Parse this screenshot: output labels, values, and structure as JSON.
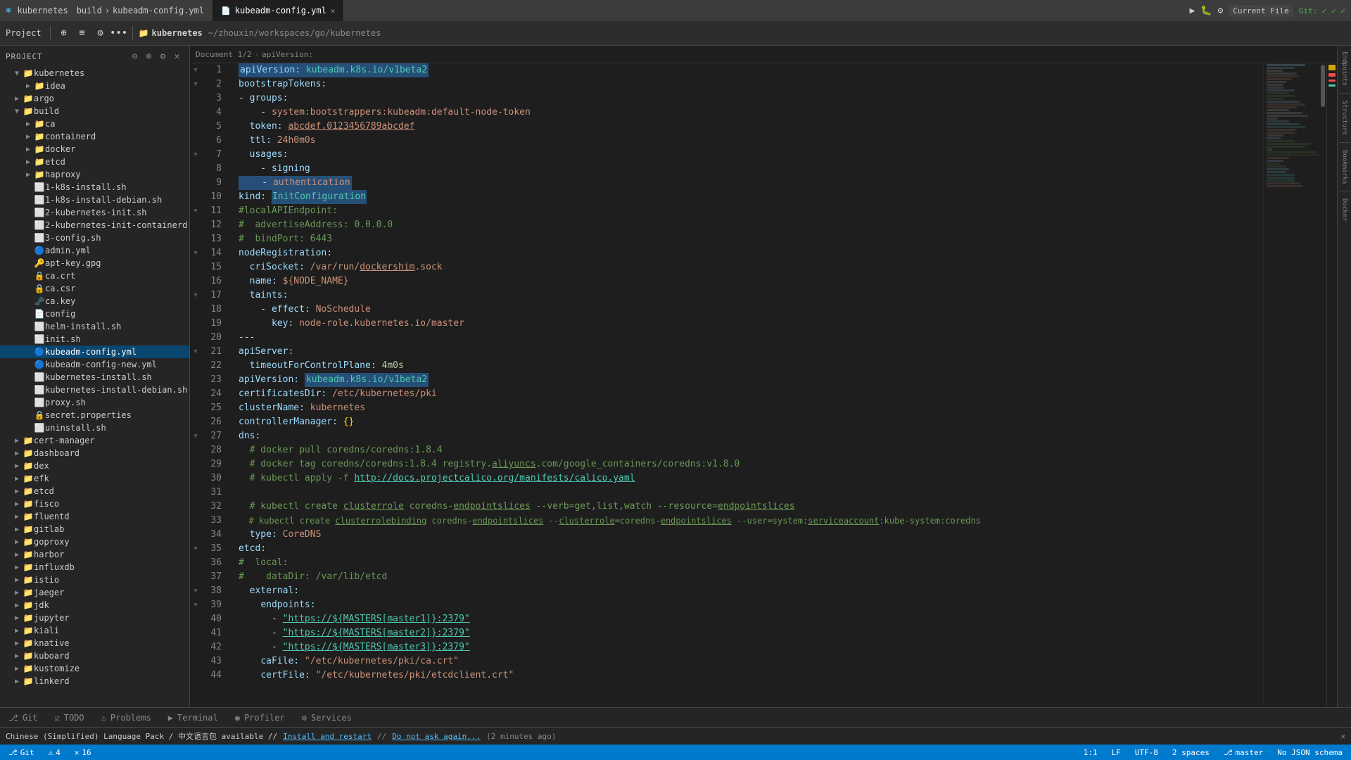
{
  "titleBar": {
    "appName": "kubernetes",
    "breadcrumb": [
      "build",
      "kubeadm-config.yml"
    ],
    "activeTab": "kubeadm-config.yml",
    "rightLabel": "Current File"
  },
  "toolbar": {
    "projectLabel": "Project",
    "folderLabel": "kubernetes",
    "pathLabel": "~/zhouxin/workspaces/go/kubernetes"
  },
  "statusBar": {
    "git": "Git",
    "gitBranch": "master",
    "warnings": "4",
    "errors": "16",
    "position": "1:1",
    "lineEnding": "LF",
    "encoding": "UTF-8",
    "indentation": "2 spaces",
    "noJsonSchema": "No JSON schema"
  },
  "bottomTabs": [
    {
      "id": "git",
      "label": "Git",
      "icon": "⎇"
    },
    {
      "id": "todo",
      "label": "TODO",
      "icon": "☑"
    },
    {
      "id": "problems",
      "label": "Problems",
      "icon": "⚠"
    },
    {
      "id": "terminal",
      "label": "Terminal",
      "icon": ">"
    },
    {
      "id": "profiler",
      "label": "Profiler",
      "icon": "◉"
    },
    {
      "id": "services",
      "label": "Services",
      "icon": "⚙"
    }
  ],
  "notification": {
    "text": "Chinese (Simplified) Language Pack / 中文语言包 available // Install and restart // Do not ask again... (2 minutes ago)"
  },
  "fileTree": {
    "root": "kubernetes",
    "items": [
      {
        "id": "idea",
        "name": "idea",
        "type": "folder",
        "depth": 2,
        "open": false
      },
      {
        "id": "argo",
        "name": "argo",
        "type": "folder",
        "depth": 1,
        "open": false
      },
      {
        "id": "build",
        "name": "build",
        "type": "folder",
        "depth": 1,
        "open": true
      },
      {
        "id": "ca",
        "name": "ca",
        "type": "folder",
        "depth": 2,
        "open": false
      },
      {
        "id": "containerd",
        "name": "containerd",
        "type": "folder",
        "depth": 2,
        "open": false
      },
      {
        "id": "docker",
        "name": "docker",
        "type": "folder",
        "depth": 2,
        "open": false
      },
      {
        "id": "etcd",
        "name": "etcd",
        "type": "folder",
        "depth": 2,
        "open": false
      },
      {
        "id": "haproxy",
        "name": "haproxy",
        "type": "folder",
        "depth": 2,
        "open": false
      },
      {
        "id": "1k8s-install",
        "name": "1-k8s-install.sh",
        "type": "file",
        "ext": "sh",
        "depth": 2
      },
      {
        "id": "1k8s-install-debian",
        "name": "1-k8s-install-debian.sh",
        "type": "file",
        "ext": "sh",
        "depth": 2
      },
      {
        "id": "2kubernetes-init",
        "name": "2-kubernetes-init.sh",
        "type": "file",
        "ext": "sh",
        "depth": 2
      },
      {
        "id": "2kubernetes-init-containerd",
        "name": "2-kubernetes-init-containerd.sh",
        "type": "file",
        "ext": "sh",
        "depth": 2
      },
      {
        "id": "3config",
        "name": "3-config.sh",
        "type": "file",
        "ext": "sh",
        "depth": 2
      },
      {
        "id": "admin-yml",
        "name": "admin.yml",
        "type": "file",
        "ext": "yml",
        "depth": 2
      },
      {
        "id": "apt-key",
        "name": "apt-key.gpg",
        "type": "file",
        "ext": "gpg",
        "depth": 2
      },
      {
        "id": "ca-crt",
        "name": "ca.crt",
        "type": "file",
        "ext": "crt",
        "depth": 2
      },
      {
        "id": "ca-csr",
        "name": "ca.csr",
        "type": "file",
        "ext": "csr",
        "depth": 2
      },
      {
        "id": "ca-key",
        "name": "ca.key",
        "type": "file",
        "ext": "key",
        "depth": 2
      },
      {
        "id": "config",
        "name": "config",
        "type": "file",
        "ext": "",
        "depth": 2
      },
      {
        "id": "helm-install",
        "name": "helm-install.sh",
        "type": "file",
        "ext": "sh",
        "depth": 2
      },
      {
        "id": "init-sh",
        "name": "init.sh",
        "type": "file",
        "ext": "sh",
        "depth": 2
      },
      {
        "id": "kubeadm-config-yml",
        "name": "kubeadm-config.yml",
        "type": "file",
        "ext": "yml",
        "depth": 2,
        "selected": true
      },
      {
        "id": "kubeadm-config-new",
        "name": "kubeadm-config-new.yml",
        "type": "file",
        "ext": "yml",
        "depth": 2
      },
      {
        "id": "kubernetes-install",
        "name": "kubernetes-install.sh",
        "type": "file",
        "ext": "sh",
        "depth": 2
      },
      {
        "id": "kubernetes-install-debian",
        "name": "kubernetes-install-debian.sh",
        "type": "file",
        "ext": "sh",
        "depth": 2
      },
      {
        "id": "proxy-sh",
        "name": "proxy.sh",
        "type": "file",
        "ext": "sh",
        "depth": 2
      },
      {
        "id": "secret-props",
        "name": "secret.properties",
        "type": "file",
        "ext": "props",
        "depth": 2
      },
      {
        "id": "uninstall-sh",
        "name": "uninstall.sh",
        "type": "file",
        "ext": "sh",
        "depth": 2
      },
      {
        "id": "cert-manager",
        "name": "cert-manager",
        "type": "folder",
        "depth": 1,
        "open": false
      },
      {
        "id": "dashboard",
        "name": "dashboard",
        "type": "folder",
        "depth": 1,
        "open": false
      },
      {
        "id": "dex",
        "name": "dex",
        "type": "folder",
        "depth": 1,
        "open": false
      },
      {
        "id": "efk",
        "name": "efk",
        "type": "folder",
        "depth": 1,
        "open": false
      },
      {
        "id": "etcd2",
        "name": "etcd",
        "type": "folder",
        "depth": 1,
        "open": false
      },
      {
        "id": "fisco",
        "name": "fisco",
        "type": "folder",
        "depth": 1,
        "open": false
      },
      {
        "id": "fluentd",
        "name": "fluentd",
        "type": "folder",
        "depth": 1,
        "open": false
      },
      {
        "id": "gitlab",
        "name": "gitlab",
        "type": "folder",
        "depth": 1,
        "open": false
      },
      {
        "id": "goproxy",
        "name": "goproxy",
        "type": "folder",
        "depth": 1,
        "open": false
      },
      {
        "id": "harbor",
        "name": "harbor",
        "type": "folder",
        "depth": 1,
        "open": false
      },
      {
        "id": "influxdb",
        "name": "influxdb",
        "type": "folder",
        "depth": 1,
        "open": false
      },
      {
        "id": "istio",
        "name": "istio",
        "type": "folder",
        "depth": 1,
        "open": false
      },
      {
        "id": "jaeger",
        "name": "jaeger",
        "type": "folder",
        "depth": 1,
        "open": false
      },
      {
        "id": "jdk",
        "name": "jdk",
        "type": "folder",
        "depth": 1,
        "open": false
      },
      {
        "id": "jupyter",
        "name": "jupyter",
        "type": "folder",
        "depth": 1,
        "open": false
      },
      {
        "id": "kiali",
        "name": "kiali",
        "type": "folder",
        "depth": 1,
        "open": false
      },
      {
        "id": "knative",
        "name": "knative",
        "type": "folder",
        "depth": 1,
        "open": false
      },
      {
        "id": "kuboard",
        "name": "kuboard",
        "type": "folder",
        "depth": 1,
        "open": false
      },
      {
        "id": "kustomize",
        "name": "kustomize",
        "type": "folder",
        "depth": 1,
        "open": false
      },
      {
        "id": "linkerd",
        "name": "linkerd",
        "type": "folder",
        "depth": 1,
        "open": false
      }
    ]
  },
  "editor": {
    "filename": "kubeadm-config.yml",
    "documentInfo": "Document 1/2",
    "breadcrumb": "apiVersion:",
    "lines": [
      {
        "num": 1,
        "tokens": [
          {
            "t": "key",
            "v": "apiVersion: "
          },
          {
            "t": "val-hl",
            "v": "kubeadm.k8s.io/v1beta2"
          }
        ]
      },
      {
        "num": 2,
        "tokens": [
          {
            "t": "key",
            "v": "bootstrapTokens:"
          }
        ]
      },
      {
        "num": 3,
        "tokens": [
          {
            "t": "dash",
            "v": "- "
          },
          {
            "t": "key",
            "v": "groups:"
          }
        ]
      },
      {
        "num": 4,
        "tokens": [
          {
            "t": "spaces",
            "v": "    "
          },
          {
            "t": "dash",
            "v": "- "
          },
          {
            "t": "key",
            "v": "system:bootstrappers:kubeadm:default-node-token"
          }
        ]
      },
      {
        "num": 5,
        "tokens": [
          {
            "t": "spaces",
            "v": "  "
          },
          {
            "t": "key",
            "v": "token: "
          },
          {
            "t": "val",
            "v": "abcdef.0123456789abcdef"
          }
        ]
      },
      {
        "num": 6,
        "tokens": [
          {
            "t": "spaces",
            "v": "  "
          },
          {
            "t": "key",
            "v": "ttl: "
          },
          {
            "t": "val",
            "v": "24h0m0s"
          }
        ]
      },
      {
        "num": 7,
        "tokens": [
          {
            "t": "spaces",
            "v": "  "
          },
          {
            "t": "key",
            "v": "usages:"
          }
        ]
      },
      {
        "num": 8,
        "tokens": [
          {
            "t": "spaces",
            "v": "    "
          },
          {
            "t": "dash",
            "v": "- "
          },
          {
            "t": "key",
            "v": "signing"
          }
        ]
      },
      {
        "num": 9,
        "tokens": [
          {
            "t": "spaces",
            "v": "    "
          },
          {
            "t": "dash",
            "v": "- "
          },
          {
            "t": "val-hl2",
            "v": "authentication"
          }
        ]
      },
      {
        "num": 10,
        "tokens": [
          {
            "t": "key",
            "v": "kind: "
          },
          {
            "t": "val-hl",
            "v": "InitConfiguration"
          }
        ]
      },
      {
        "num": 11,
        "tokens": [
          {
            "t": "comment",
            "v": "#localAPIEndpoint:"
          }
        ]
      },
      {
        "num": 12,
        "tokens": [
          {
            "t": "comment",
            "v": "#  advertiseAddress: 0.0.0.0"
          }
        ]
      },
      {
        "num": 13,
        "tokens": [
          {
            "t": "comment",
            "v": "#  bindPort: 6443"
          }
        ]
      },
      {
        "num": 14,
        "tokens": [
          {
            "t": "key",
            "v": "nodeRegistration:"
          }
        ]
      },
      {
        "num": 15,
        "tokens": [
          {
            "t": "spaces",
            "v": "  "
          },
          {
            "t": "key",
            "v": "criSocket: "
          },
          {
            "t": "val",
            "v": "/var/run/dockershim.sock"
          }
        ]
      },
      {
        "num": 16,
        "tokens": [
          {
            "t": "spaces",
            "v": "  "
          },
          {
            "t": "key",
            "v": "name: "
          },
          {
            "t": "val",
            "v": "${NODE_NAME}"
          }
        ]
      },
      {
        "num": 17,
        "tokens": [
          {
            "t": "spaces",
            "v": "  "
          },
          {
            "t": "key",
            "v": "taints:"
          }
        ]
      },
      {
        "num": 18,
        "tokens": [
          {
            "t": "spaces",
            "v": "    "
          },
          {
            "t": "dash",
            "v": "- "
          },
          {
            "t": "key",
            "v": "effect: "
          },
          {
            "t": "val",
            "v": "NoSchedule"
          }
        ]
      },
      {
        "num": 19,
        "tokens": [
          {
            "t": "spaces",
            "v": "      "
          },
          {
            "t": "key",
            "v": "key: "
          },
          {
            "t": "val",
            "v": "node-role.kubernetes.io/master"
          }
        ]
      },
      {
        "num": 20,
        "tokens": [
          {
            "t": "dash",
            "v": "---"
          }
        ]
      },
      {
        "num": 21,
        "tokens": [
          {
            "t": "key",
            "v": "apiServer:"
          }
        ]
      },
      {
        "num": 22,
        "tokens": [
          {
            "t": "spaces",
            "v": "  "
          },
          {
            "t": "key",
            "v": "timeoutForControlPlane: "
          },
          {
            "t": "val",
            "v": "4m0s"
          }
        ]
      },
      {
        "num": 23,
        "tokens": [
          {
            "t": "key",
            "v": "apiVersion: "
          },
          {
            "t": "val-hl",
            "v": "kubeadm.k8s.io/v1beta2"
          }
        ]
      },
      {
        "num": 24,
        "tokens": [
          {
            "t": "key",
            "v": "certificatesDir: "
          },
          {
            "t": "val",
            "v": "/etc/kubernetes/pki"
          }
        ]
      },
      {
        "num": 25,
        "tokens": [
          {
            "t": "key",
            "v": "clusterName: "
          },
          {
            "t": "val",
            "v": "kubernetes"
          }
        ]
      },
      {
        "num": 26,
        "tokens": [
          {
            "t": "key",
            "v": "controllerManager: "
          },
          {
            "t": "bracket",
            "v": "{}"
          }
        ]
      },
      {
        "num": 27,
        "tokens": [
          {
            "t": "key",
            "v": "dns:"
          }
        ]
      },
      {
        "num": 28,
        "tokens": [
          {
            "t": "comment",
            "v": "  # docker pull coredns/coredns:1.8.4"
          }
        ]
      },
      {
        "num": 29,
        "tokens": [
          {
            "t": "comment",
            "v": "  # docker tag coredns/coredns:1.8.4 registry.aliyuncs.com/google_containers/coredns:v1.8.0"
          }
        ]
      },
      {
        "num": 30,
        "tokens": [
          {
            "t": "comment",
            "v": "  # kubectl apply -f "
          },
          {
            "t": "url",
            "v": "http://docs.projectcalico.org/manifests/calico.yaml"
          }
        ]
      },
      {
        "num": 31,
        "tokens": []
      },
      {
        "num": 32,
        "tokens": [
          {
            "t": "comment",
            "v": "  # kubectl create clusterrole coredns-endpointslices --verb=get,list,watch --resource=endpointslices"
          }
        ]
      },
      {
        "num": 33,
        "tokens": [
          {
            "t": "comment",
            "v": "  # kubectl create clusterrolebinding coredns-endpointslices --clusterrole=coredns-endpointslices --user=system:serviceaccount:kube-system:coredns"
          }
        ]
      },
      {
        "num": 34,
        "tokens": [
          {
            "t": "spaces",
            "v": "  "
          },
          {
            "t": "key",
            "v": "type: "
          },
          {
            "t": "val",
            "v": "CoreDNS"
          }
        ]
      },
      {
        "num": 35,
        "tokens": [
          {
            "t": "key",
            "v": "etcd:"
          }
        ]
      },
      {
        "num": 36,
        "tokens": [
          {
            "t": "comment",
            "v": "#  local:"
          }
        ]
      },
      {
        "num": 37,
        "tokens": [
          {
            "t": "comment",
            "v": "#    dataDir: /var/lib/etcd"
          }
        ]
      },
      {
        "num": 38,
        "tokens": [
          {
            "t": "spaces",
            "v": "  "
          },
          {
            "t": "key",
            "v": "external:"
          }
        ]
      },
      {
        "num": 39,
        "tokens": [
          {
            "t": "spaces",
            "v": "    "
          },
          {
            "t": "key",
            "v": "endpoints:"
          }
        ]
      },
      {
        "num": 40,
        "tokens": [
          {
            "t": "spaces",
            "v": "      "
          },
          {
            "t": "dash",
            "v": "- "
          },
          {
            "t": "url",
            "v": "\"https://${MASTERS[master1]}:2379\""
          }
        ]
      },
      {
        "num": 41,
        "tokens": [
          {
            "t": "spaces",
            "v": "      "
          },
          {
            "t": "dash",
            "v": "- "
          },
          {
            "t": "url",
            "v": "\"https://${MASTERS[master2]}:2379\""
          }
        ]
      },
      {
        "num": 42,
        "tokens": [
          {
            "t": "spaces",
            "v": "      "
          },
          {
            "t": "dash",
            "v": "- "
          },
          {
            "t": "url",
            "v": "\"https://${MASTERS[master3]}:2379\""
          }
        ]
      },
      {
        "num": 43,
        "tokens": [
          {
            "t": "spaces",
            "v": "    "
          },
          {
            "t": "key",
            "v": "caFile: "
          },
          {
            "t": "val",
            "v": "\"/etc/kubernetes/pki/ca.crt\""
          }
        ]
      },
      {
        "num": 44,
        "tokens": [
          {
            "t": "spaces",
            "v": "    "
          },
          {
            "t": "key",
            "v": "certFile: "
          },
          {
            "t": "val",
            "v": "\"/etc/kubernetes/pki/etcdclient.crt\""
          }
        ]
      }
    ]
  }
}
